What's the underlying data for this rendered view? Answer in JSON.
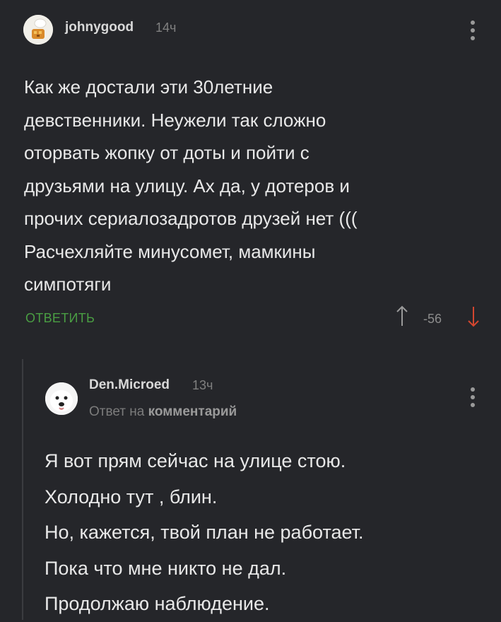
{
  "comment": {
    "username": "johnygood",
    "time": "14ч",
    "text_lines": [
      "Как же достали эти 30летние",
      "девственники. Неужели так сложно",
      "оторвать жопку от доты и пойти с",
      "друзьями на улицу. Ах да, у дотеров и",
      "прочих сериалозадротов друзей нет (((",
      "Расчехляйте минусомет, мамкины",
      "симпотяги"
    ],
    "reply_label": "ОТВЕТИТЬ",
    "rating": "-56"
  },
  "reply": {
    "username": "Den.Microed",
    "time": "13ч",
    "reply_prefix": "Ответ на",
    "reply_target": "комментарий",
    "text_lines": [
      "Я вот прям сейчас на улице стою.",
      "Холодно тут , блин.",
      "Но, кажется, твой план не работает.",
      "Пока что мне никто не дал.",
      "Продолжаю наблюдение."
    ]
  },
  "colors": {
    "background": "#25262a",
    "accent_green": "#4a9e43",
    "downvote_red": "#d4462f"
  }
}
